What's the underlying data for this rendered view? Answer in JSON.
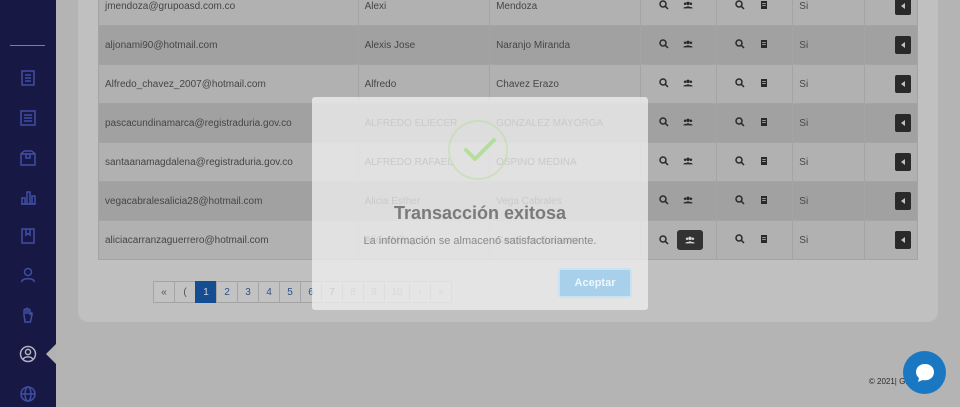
{
  "colors": {
    "sidebar": "#1d1e52",
    "primary": "#1a5fb4",
    "success": "#a5dc86",
    "chat": "#1a78c2"
  },
  "sidebar": {
    "icons": [
      "document-icon",
      "list-icon",
      "box-icon",
      "bar-chart-icon",
      "book-icon",
      "user-icon",
      "hand-icon",
      "user-circle-icon",
      "globe-icon"
    ],
    "active": "user-circle-icon"
  },
  "table": {
    "rows": [
      {
        "email": "jmendoza@grupoasd.com.co",
        "first_name": "Alexi",
        "last_name": "Mendoza",
        "active": "Si"
      },
      {
        "email": "aljonami90@hotmail.com",
        "first_name": "Alexis Jose",
        "last_name": "Naranjo Miranda",
        "active": "Si"
      },
      {
        "email": "Alfredo_chavez_2007@hotmail.com",
        "first_name": "Alfredo",
        "last_name": "Chavez Erazo",
        "active": "Si"
      },
      {
        "email": "pascacundinamarca@registraduria.gov.co",
        "first_name": "ALFREDO ELIECER",
        "last_name": "GONZALEZ MAYORGA",
        "active": "Si"
      },
      {
        "email": "santaanamagdalena@registraduria.gov.co",
        "first_name": "ALFREDO RAFAEL",
        "last_name": "OSPINO MEDINA",
        "active": "Si"
      },
      {
        "email": "vegacabralesalicia28@hotmail.com",
        "first_name": "Alicia Esther",
        "last_name": "Vega Cabrales",
        "active": "Si"
      },
      {
        "email": "aliciacarranzaguerrero@hotmail.com",
        "first_name": "Alicia Milagro",
        "last_name": "Carranza Gamarra",
        "active": "Si"
      }
    ]
  },
  "pagination": {
    "first": "«",
    "prev": "(",
    "pages": [
      "1",
      "2",
      "3",
      "4",
      "5",
      "6",
      "7",
      "8",
      "9",
      "10"
    ],
    "current": "1",
    "next": "›",
    "last": "»"
  },
  "modal": {
    "title": "Transacción exitosa",
    "message": "La información se almacenó satisfactoriamente.",
    "button": "Aceptar"
  },
  "footer": {
    "text": "© 2021| Gr"
  }
}
